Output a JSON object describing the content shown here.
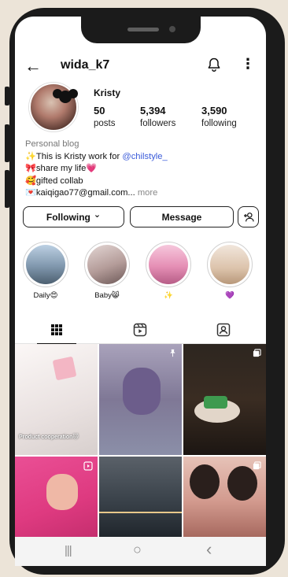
{
  "header": {
    "back_icon": "arrow-left-icon",
    "username": "wida_k7",
    "bell_icon": "bell-icon",
    "more_icon": "more-vertical-icon"
  },
  "profile": {
    "display_name": "Kristy",
    "stats": [
      {
        "value": "50",
        "label": "posts"
      },
      {
        "value": "5,394",
        "label": "followers"
      },
      {
        "value": "3,590",
        "label": "following"
      }
    ]
  },
  "bio": {
    "category": "Personal blog",
    "line1_prefix": "✨This is Kristy work for ",
    "line1_link": "@chilstyle_",
    "line2": "🎀share my life💗",
    "line3": "🥰gifted collab",
    "line4": "💌kaiqigao77@gmail.com...",
    "more": " more"
  },
  "actions": {
    "following": "Following",
    "following_chevron": "⌄",
    "message": "Message",
    "add_user_icon": "add-user-icon"
  },
  "highlights": [
    {
      "label": "Daily😍",
      "color": "#9fb3c8"
    },
    {
      "label": "Baby😸",
      "color": "#c9b7b4"
    },
    {
      "label": "✨",
      "color": "#e9a6c5"
    },
    {
      "label": "💜",
      "color": "#e2cdb9"
    }
  ],
  "tabs": [
    {
      "name": "grid-icon"
    },
    {
      "name": "reels-icon"
    },
    {
      "name": "tagged-icon"
    }
  ],
  "grid": [
    {
      "color": "#f1ecec",
      "overlay": "Product cooperation🐱"
    },
    {
      "color": "#8f88a6",
      "overlay": ""
    },
    {
      "color": "#2b211b",
      "overlay": ""
    },
    {
      "color": "#e63f8a",
      "overlay": ""
    },
    {
      "color": "#3d4751",
      "overlay": ""
    },
    {
      "color": "#d8a9a0",
      "overlay": ""
    }
  ],
  "navbar": {
    "recents": "|||",
    "home": "○",
    "back": "‹"
  }
}
